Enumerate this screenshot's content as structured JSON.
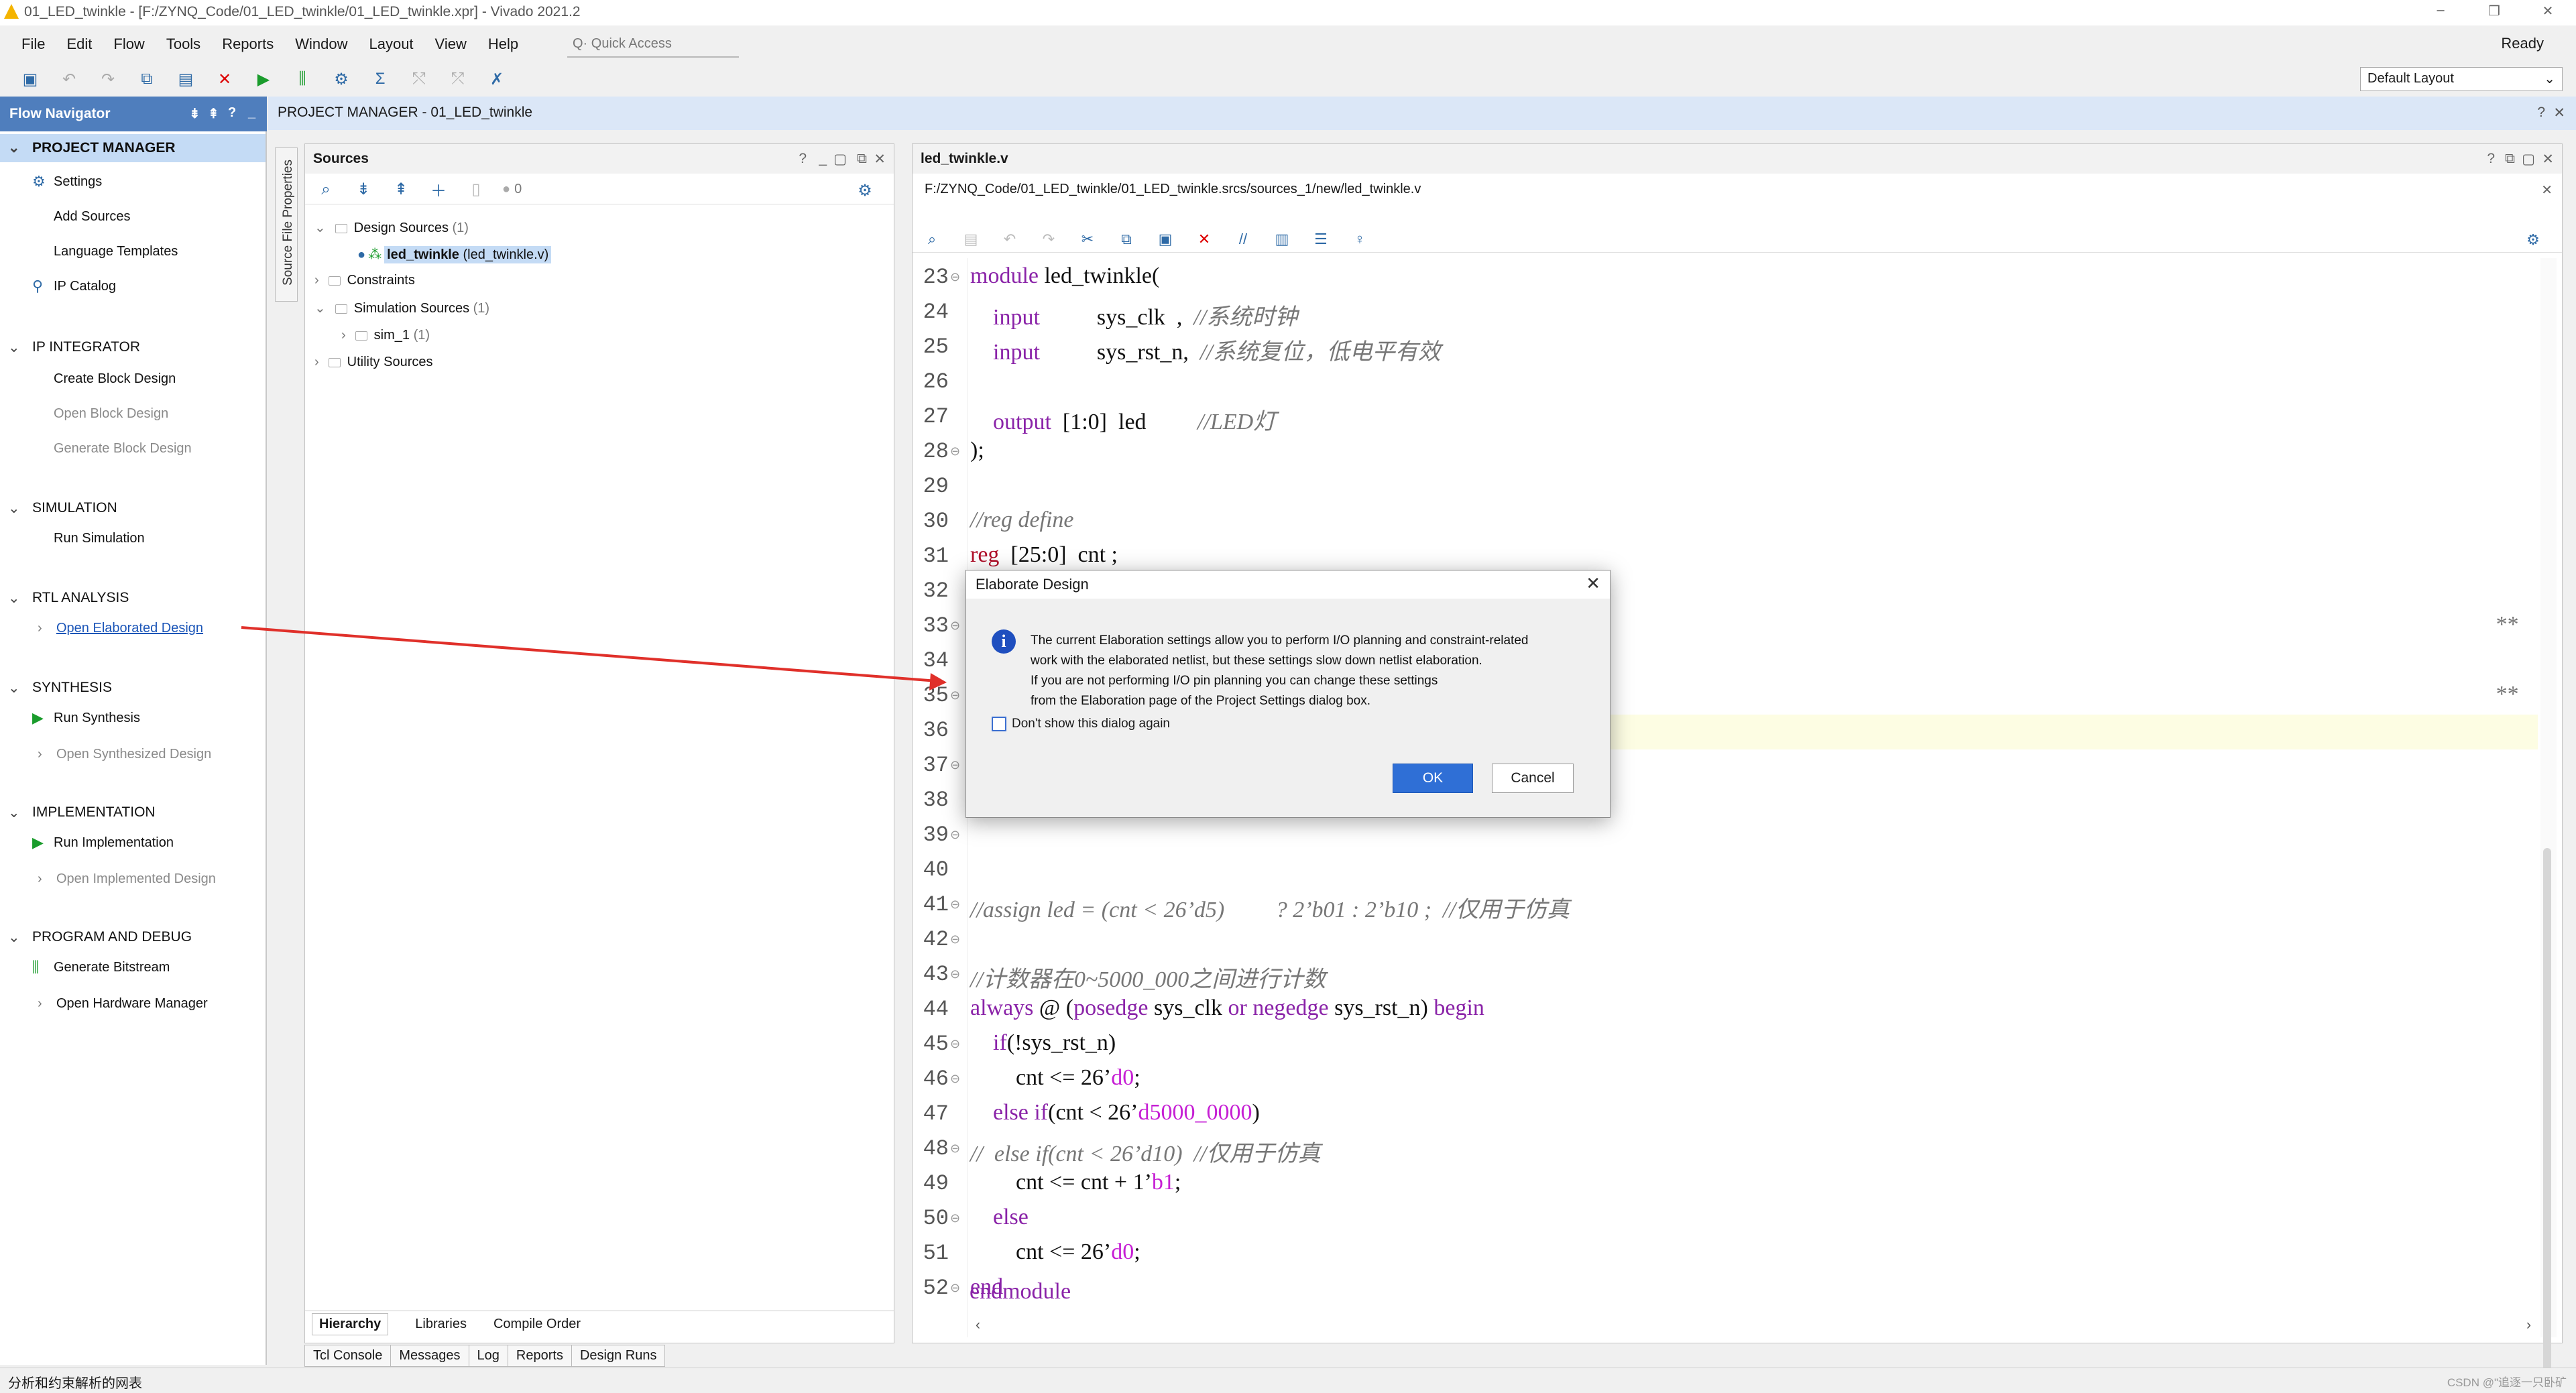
{
  "window": {
    "title": "01_LED_twinkle - [F:/ZYNQ_Code/01_LED_twinkle/01_LED_twinkle.xpr] - Vivado 2021.2",
    "status": "Ready"
  },
  "menu": [
    "File",
    "Edit",
    "Flow",
    "Tools",
    "Reports",
    "Window",
    "Layout",
    "View",
    "Help"
  ],
  "quick_access": "Q· Quick Access",
  "layout_select": "Default Layout",
  "flow_nav": {
    "title": "Flow Navigator",
    "sections": [
      {
        "title": "PROJECT MANAGER",
        "items": [
          "Settings",
          "Add Sources",
          "Language Templates",
          "IP Catalog"
        ]
      },
      {
        "title": "IP INTEGRATOR",
        "items": [
          "Create Block Design",
          "Open Block Design",
          "Generate Block Design"
        ]
      },
      {
        "title": "SIMULATION",
        "items": [
          "Run Simulation"
        ]
      },
      {
        "title": "RTL ANALYSIS",
        "items": [
          "Open Elaborated Design"
        ]
      },
      {
        "title": "SYNTHESIS",
        "items": [
          "Run Synthesis",
          "Open Synthesized Design"
        ]
      },
      {
        "title": "IMPLEMENTATION",
        "items": [
          "Run Implementation",
          "Open Implemented Design"
        ]
      },
      {
        "title": "PROGRAM AND DEBUG",
        "items": [
          "Generate Bitstream",
          "Open Hardware Manager"
        ]
      }
    ]
  },
  "pm_header": {
    "label": "PROJECT MANAGER",
    "project": " - 01_LED_twinkle"
  },
  "side_tab": "Source File Properties",
  "sources": {
    "title": "Sources",
    "badge": "0",
    "design_sources": "Design Sources",
    "design_count": "(1)",
    "top_module": "led_twinkle",
    "top_file": "(led_twinkle.v)",
    "constraints": "Constraints",
    "sim_sources": "Simulation Sources",
    "sim_count": "(1)",
    "sim_set": "sim_1",
    "sim_set_count": "(1)",
    "utility": "Utility Sources",
    "tabs": [
      "Hierarchy",
      "Libraries",
      "Compile Order"
    ]
  },
  "console_tabs": [
    "Tcl Console",
    "Messages",
    "Log",
    "Reports",
    "Design Runs"
  ],
  "editor": {
    "tab": "led_twinkle.v",
    "path": "F:/ZYNQ_Code/01_LED_twinkle/01_LED_twinkle.srcs/sources_1/new/led_twinkle.v",
    "line_numbers": [
      "23",
      "24",
      "25",
      "26",
      "27",
      "28",
      "29",
      "30",
      "31",
      "32",
      "33",
      "34",
      "35",
      "36",
      "37",
      "38",
      "39",
      "40",
      "41",
      "42",
      "43",
      "44",
      "45",
      "46",
      "47",
      "48",
      "49",
      "50",
      "51",
      "52"
    ]
  },
  "dialog": {
    "title": "Elaborate Design",
    "message": [
      "The current Elaboration settings allow you to perform I/O planning and constraint-related",
      "work with the elaborated netlist, but these settings slow down netlist elaboration.",
      "If you are not performing I/O pin planning you can change these settings",
      "from the Elaboration page of the Project Settings dialog box."
    ],
    "checkbox": "Don't show this dialog again",
    "ok": "OK",
    "cancel": "Cancel"
  },
  "statusbar": "分析和约束解析的网表",
  "watermark": "CSDN @\"追逐一只卧矿"
}
